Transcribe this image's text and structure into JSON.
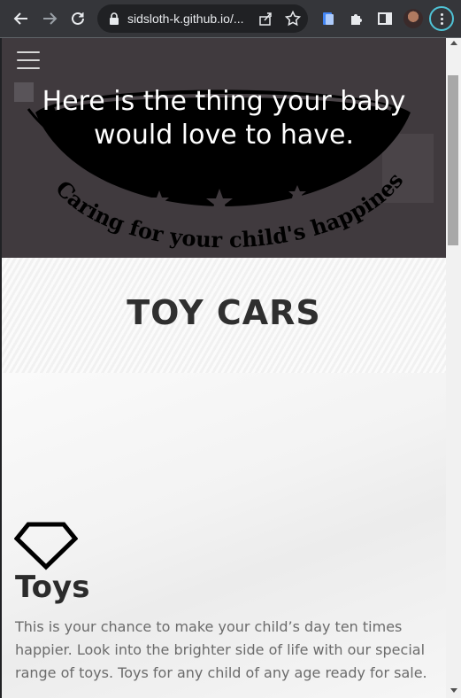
{
  "browser": {
    "url": "sidsloth-k.github.io/...",
    "accent_color": "#4fc3d6",
    "icons": [
      "back-arrow-icon",
      "forward-arrow-icon",
      "reload-icon",
      "lock-icon",
      "share-icon",
      "star-icon",
      "extension-doc-icon",
      "puzzle-icon",
      "side-panel-icon",
      "profile-avatar",
      "kebab-menu-icon"
    ]
  },
  "hero": {
    "title": "Here is the thing your baby would love to have.",
    "logo_text": "Caring for your child's happiness"
  },
  "section": {
    "title": "TOY CARS"
  },
  "feature": {
    "icon": "diamond-icon",
    "title": "Toys",
    "text": "This is your chance to make your child’s day ten times happier. Look into the brighter side of life with our special range of toys. Toys for any child of any age ready for sale."
  }
}
